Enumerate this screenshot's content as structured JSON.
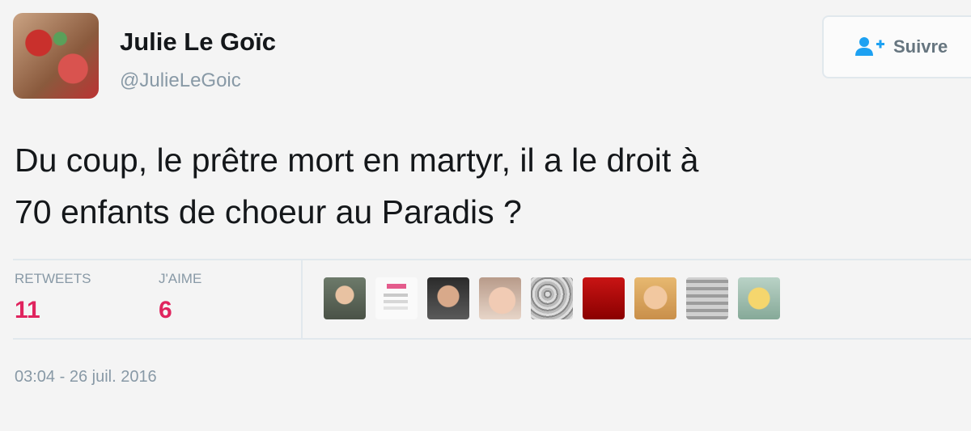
{
  "author": {
    "name": "Julie Le Goïc",
    "handle": "@JulieLeGoic"
  },
  "follow_button": {
    "label": "Suivre",
    "icon": "add-user-icon"
  },
  "tweet": {
    "text_lines": [
      "Du coup, le prêtre mort en martyr, il a le droit à",
      "70 enfants de choeur au Paradis ?"
    ],
    "timestamp": "03:04 - 26 juil. 2016"
  },
  "stats": {
    "retweets_label": "RETWEETS",
    "retweets_count": "11",
    "likes_label": "J'AIME",
    "likes_count": "6"
  },
  "likers": [
    "liker-avatar-1",
    "liker-avatar-2",
    "liker-avatar-3",
    "liker-avatar-4",
    "liker-avatar-5",
    "liker-avatar-6",
    "liker-avatar-7",
    "liker-avatar-8",
    "liker-avatar-9"
  ],
  "colors": {
    "count_accent": "#e0245e",
    "muted_text": "#8899a6",
    "follow_icon": "#1da1f2"
  }
}
